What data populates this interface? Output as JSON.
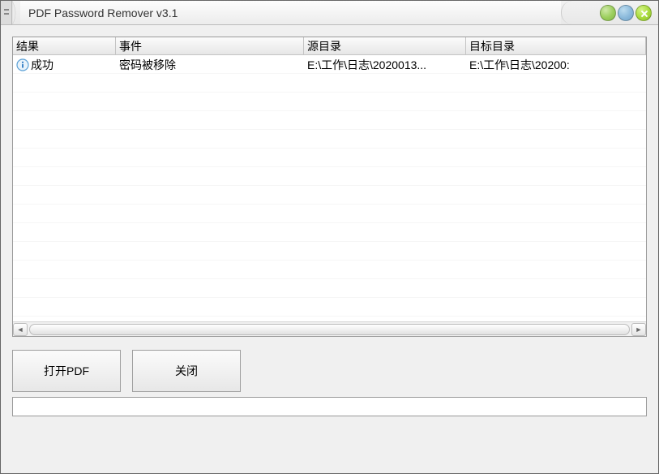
{
  "window": {
    "title": "PDF Password Remover v3.1"
  },
  "table": {
    "columns": [
      "结果",
      "事件",
      "源目录",
      "目标目录"
    ],
    "rows": [
      {
        "result": "成功",
        "event": "密码被移除",
        "src": "E:\\工作\\日志\\2020013...",
        "dst": "E:\\工作\\日志\\20200:"
      }
    ]
  },
  "buttons": {
    "open_pdf": "打开PDF",
    "close": "关闭"
  },
  "statusbar": {
    "text": ""
  }
}
